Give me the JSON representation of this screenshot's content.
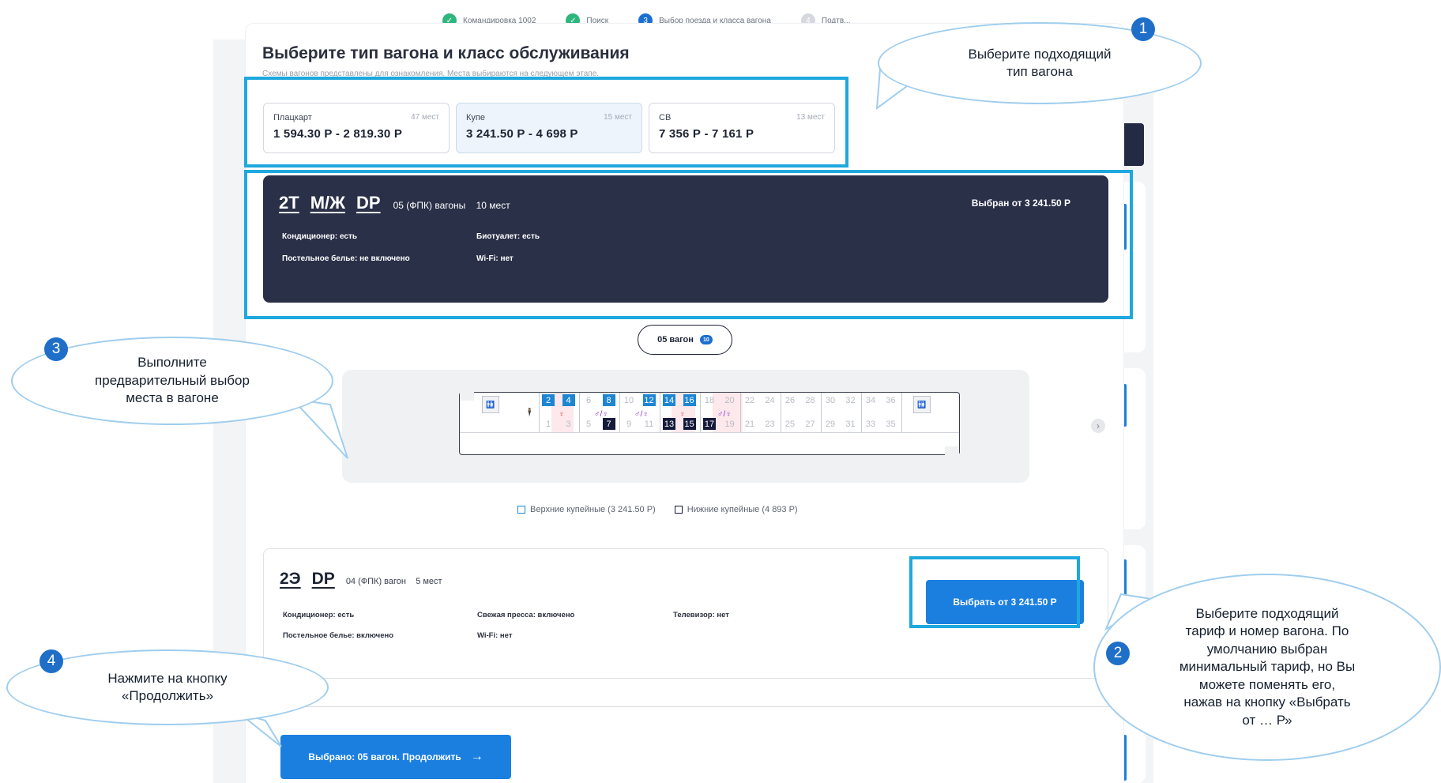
{
  "stepper": {
    "steps": [
      {
        "label": "Командировка 1002",
        "icon": "check-icon"
      },
      {
        "label": "Поиск",
        "icon": "check-icon"
      },
      {
        "label": "Выбор поезда и класса вагона",
        "number": "3"
      },
      {
        "label": "Подтв...",
        "number": "4"
      }
    ]
  },
  "modal": {
    "title": "Выберите тип вагона и класс обслуживания",
    "subtitle": "Схемы вагонов представлены для ознакомления. Места выбираются на следующем этапе."
  },
  "car_types": [
    {
      "name": "Плацкарт",
      "seats": "47 мест",
      "price": "1 594.30 Р - 2 819.30 Р"
    },
    {
      "name": "Купе",
      "seats": "15 мест",
      "price": "3 241.50 Р - 4 698 Р"
    },
    {
      "name": "СВ",
      "seats": "13 мест",
      "price": "7 356 Р - 7 161 Р"
    }
  ],
  "wagon_selected": {
    "codes": [
      "2Т",
      "М/Ж",
      "DP"
    ],
    "meta": "05 (ФПК) вагоны    10 мест",
    "chosen": "Выбран от 3 241.50 Р",
    "features": [
      "Кондиционер: есть",
      "Биотуалет: есть",
      "Постельное белье: не включено",
      "Wi-Fi: нет"
    ]
  },
  "wagon_pill": {
    "label": "05 вагон",
    "badge": "10"
  },
  "seat_map": {
    "upper": [
      "2",
      "4",
      "6",
      "8",
      "10",
      "12",
      "14",
      "16",
      "18",
      "20",
      "22",
      "24",
      "26",
      "28",
      "30",
      "32",
      "34",
      "36"
    ],
    "upper_free": [
      "2",
      "4",
      "8",
      "12",
      "14",
      "16"
    ],
    "lower": [
      "1",
      "3",
      "5",
      "7",
      "9",
      "11",
      "13",
      "15",
      "17",
      "19",
      "21",
      "23",
      "25",
      "27",
      "29",
      "31",
      "33",
      "35"
    ],
    "lower_free": [
      "7",
      "13",
      "15",
      "17"
    ],
    "icons": [
      "wc-icon",
      "person-icon",
      "female-icon",
      "mixed-gender-icon",
      "wc-icon"
    ]
  },
  "legend": {
    "upper": "Верхние купейные (3 241.50 Р)",
    "lower": "Нижние купейные (4 893 Р)"
  },
  "wagon_other": {
    "codes": [
      "2Э",
      "DP"
    ],
    "meta": "04 (ФПК) вагон    5 мест",
    "features": [
      "Кондиционер: есть",
      "Свежая пресса: включено",
      "Телевизор: нет",
      "Постельное белье: включено",
      "Wi-Fi: нет"
    ],
    "button": "Выбрать от 3 241.50 Р"
  },
  "continue_button": "Выбрано: 05 вагон. Продолжить",
  "callouts": [
    {
      "number": "1",
      "text": [
        "Выберите подходящий",
        "тип вагона"
      ]
    },
    {
      "number": "2",
      "text": [
        "Выберите подходящий",
        "тариф и номер вагона. По",
        "умолчанию выбран",
        "минимальный тариф, но Вы",
        "можете поменять его,",
        "нажав на кнопку «Выбрать",
        "от … Р»"
      ]
    },
    {
      "number": "3",
      "text": [
        "Выполните",
        "предварительный выбор",
        "места в вагоне"
      ]
    },
    {
      "number": "4",
      "text": [
        "Нажмите на кнопку",
        "«Продолжить»"
      ]
    }
  ],
  "colors": {
    "accent": "#1b7fe0",
    "dark": "#2a3048",
    "highlight": "#1ea8de",
    "callout_number": "#1f6fc8"
  }
}
